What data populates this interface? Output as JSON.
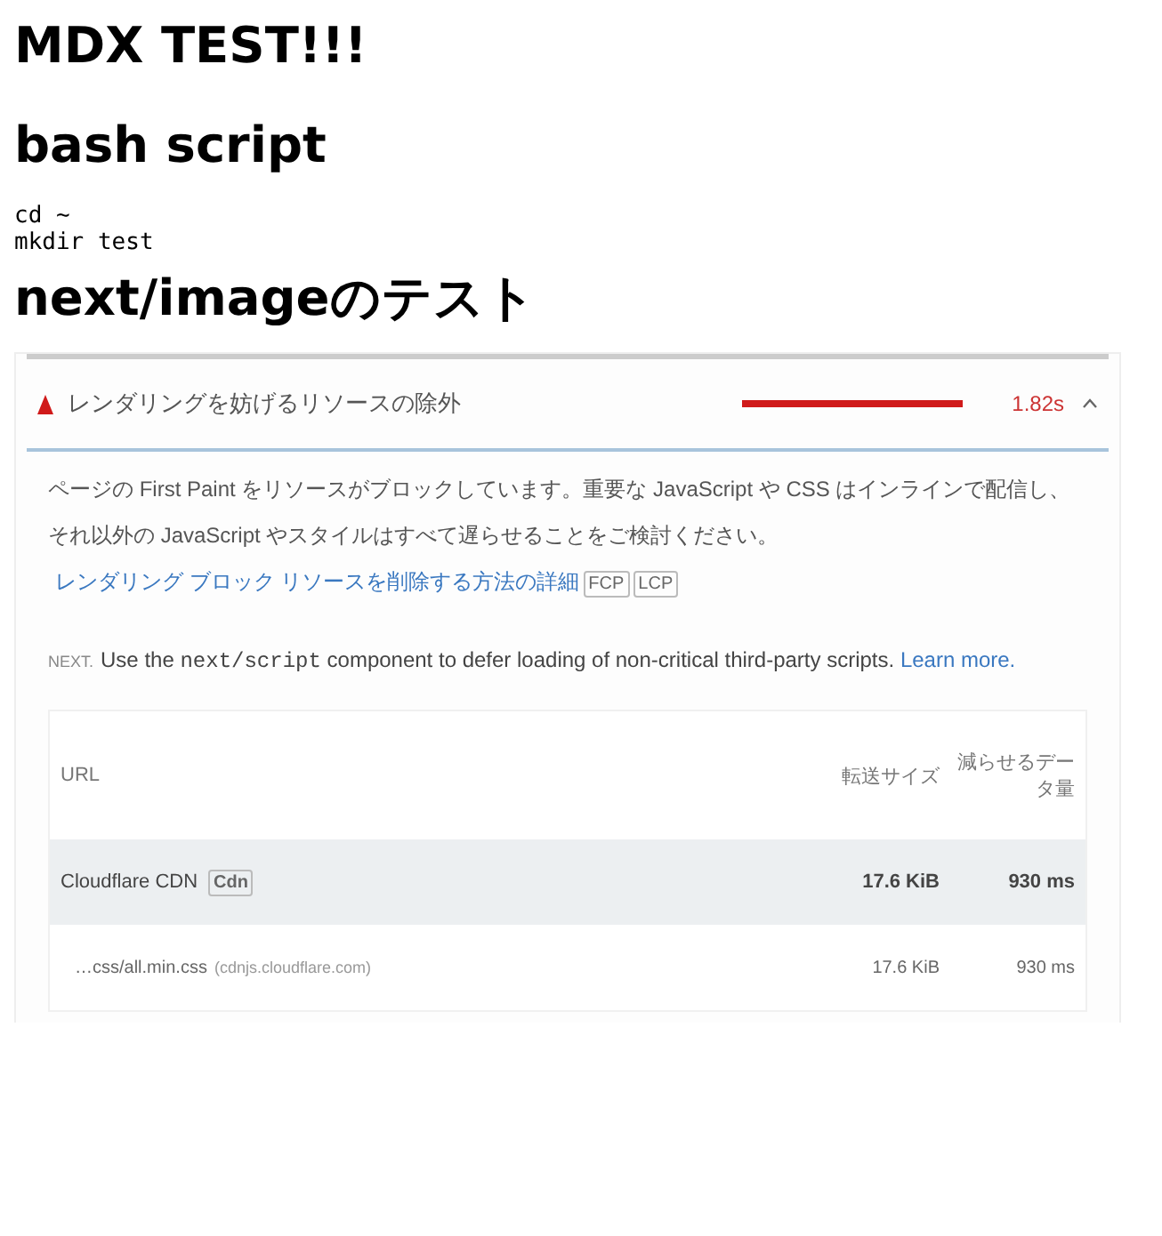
{
  "title": "MDX TEST!!!",
  "sections": [
    {
      "heading": "bash script",
      "code": [
        "cd ~",
        "mkdir test"
      ]
    },
    {
      "heading": "next/imageのテスト"
    }
  ],
  "audit": {
    "title": "レンダリングを妨げるリソースの除外",
    "savings": "1.82s",
    "expanded": true,
    "description": "ページの First Paint をリソースがブロックしています。重要な JavaScript や CSS はインラインで配信し、それ以外の JavaScript やスタイルはすべて遅らせることをご検討ください。",
    "link": "レンダリング ブロック リソースを削除する方法の詳細",
    "badges": [
      "FCP",
      "LCP"
    ],
    "stack_label": "NEXT.",
    "stack_before": "Use the",
    "stack_code": "next/script",
    "stack_after": "component to defer loading of non-critical third-party scripts.",
    "stack_link": "Learn more.",
    "columns": [
      "URL",
      "転送サイズ",
      "減らせるデータ量"
    ],
    "rows": [
      {
        "kind": "group",
        "url": "Cloudflare CDN",
        "tag": "Cdn",
        "size": "17.6 KiB",
        "savings": "930 ms"
      },
      {
        "kind": "item",
        "url": "…css/all.min.css",
        "host": "(cdnjs.cloudflare.com)",
        "size": "17.6 KiB",
        "savings": "930 ms"
      }
    ]
  }
}
